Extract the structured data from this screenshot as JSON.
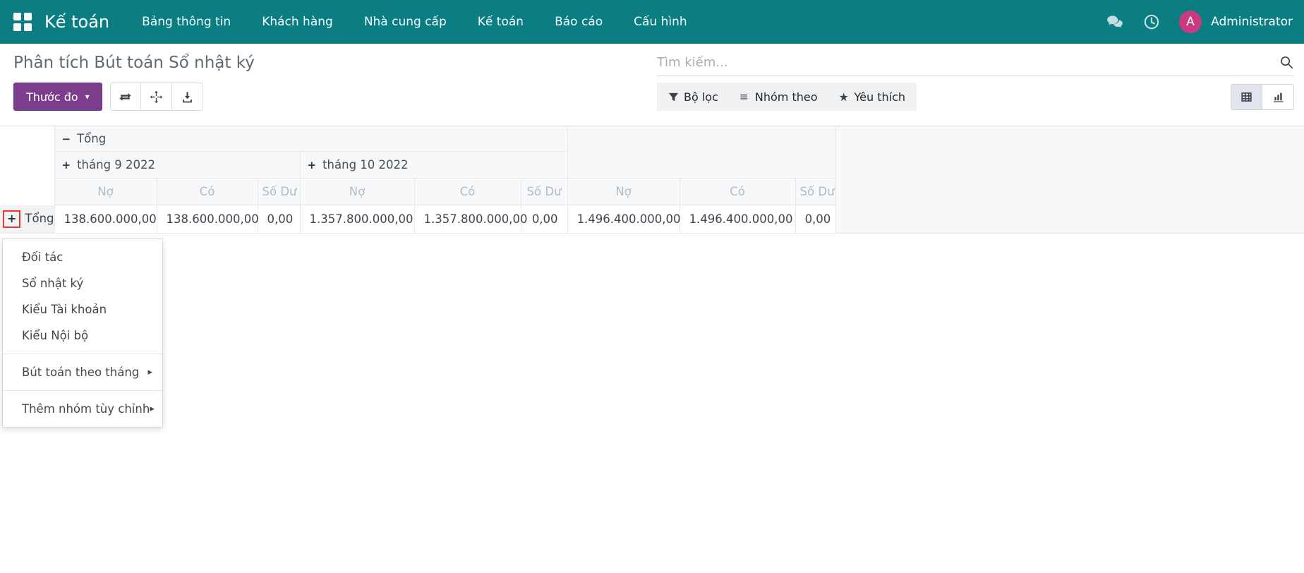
{
  "topbar": {
    "brand": "Kế toán",
    "menus": [
      "Bảng thông tin",
      "Khách hàng",
      "Nhà cung cấp",
      "Kế toán",
      "Báo cáo",
      "Cấu hình"
    ],
    "avatar_initial": "A",
    "user": "Administrator"
  },
  "control_panel": {
    "title": "Phân tích Bút toán Sổ nhật ký",
    "search_placeholder": "Tìm kiếm...",
    "measure_button": "Thước đo",
    "measure_caret": "▾",
    "filter_label": "Bộ lọc",
    "groupby_label": "Nhóm theo",
    "favorites_label": "Yêu thích"
  },
  "pivot": {
    "col_root": "Tổng",
    "col_root_toggle": "−",
    "col_groups": [
      "tháng 9 2022",
      "tháng 10 2022"
    ],
    "col_group_toggle": "+",
    "measures": [
      "Nợ",
      "Có",
      "Số Dư"
    ],
    "row_total_label": "Tổng",
    "row_toggle": "+",
    "values": [
      "138.600.000,00",
      "138.600.000,00",
      "0,00",
      "1.357.800.000,00",
      "1.357.800.000,00",
      "0,00",
      "1.496.400.000,00",
      "1.496.400.000,00",
      "0,00"
    ]
  },
  "groupby_menu": {
    "items": [
      "Đối tác",
      "Sổ nhật ký",
      "Kiểu Tài khoản",
      "Kiểu Nội bộ"
    ],
    "submenu_arrow": "▸",
    "expandables": [
      "Bút toán theo tháng",
      "Thêm nhóm tùy chỉnh"
    ]
  },
  "colors": {
    "topbar_bg": "#0b7e84",
    "avatar_bg": "#c93a81",
    "primary_button_bg": "#7b3d8c",
    "highlight_box_border": "#e8382f",
    "header_cell_bg": "#f7f8f9",
    "active_view_bg": "#e2e5ee"
  }
}
